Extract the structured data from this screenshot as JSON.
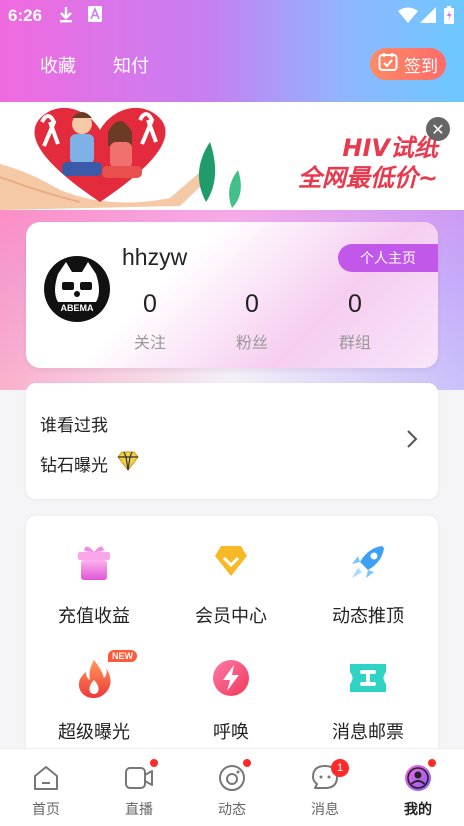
{
  "status_bar": {
    "time": "6:26"
  },
  "top_tabs": {
    "favorites": "收藏",
    "zhifu": "知付",
    "sign_in": "签到"
  },
  "banner": {
    "line1": "HIV试纸",
    "line2": "全网最低价~"
  },
  "profile": {
    "username": "hhzyw",
    "homepage_button": "个人主页",
    "avatar_text": "ABEMA",
    "stats": [
      {
        "value": "0",
        "label": "关注"
      },
      {
        "value": "0",
        "label": "粉丝"
      },
      {
        "value": "0",
        "label": "群组"
      }
    ]
  },
  "visitors": {
    "title": "谁看过我",
    "subtitle": "钻石曝光"
  },
  "features": [
    {
      "label": "充值收益",
      "icon": "gift-icon"
    },
    {
      "label": "会员中心",
      "icon": "vip-diamond-icon"
    },
    {
      "label": "动态推顶",
      "icon": "rocket-icon"
    },
    {
      "label": "超级曝光",
      "icon": "fire-icon",
      "badge": "NEW"
    },
    {
      "label": "呼唤",
      "icon": "lightning-icon"
    },
    {
      "label": "消息邮票",
      "icon": "message-ticket-icon"
    }
  ],
  "bottom_nav": [
    {
      "label": "首页",
      "icon": "home-icon"
    },
    {
      "label": "直播",
      "icon": "live-video-icon",
      "dot": true
    },
    {
      "label": "动态",
      "icon": "moments-icon",
      "dot": true
    },
    {
      "label": "消息",
      "icon": "message-icon",
      "count": "1"
    },
    {
      "label": "我的",
      "icon": "profile-icon",
      "dot": true,
      "active": true
    }
  ],
  "colors": {
    "accent_purple": "#c158ea",
    "sign_in_orange": "#ff7a5e",
    "badge_red": "#ff2b2b",
    "banner_red": "#e83a4e"
  }
}
